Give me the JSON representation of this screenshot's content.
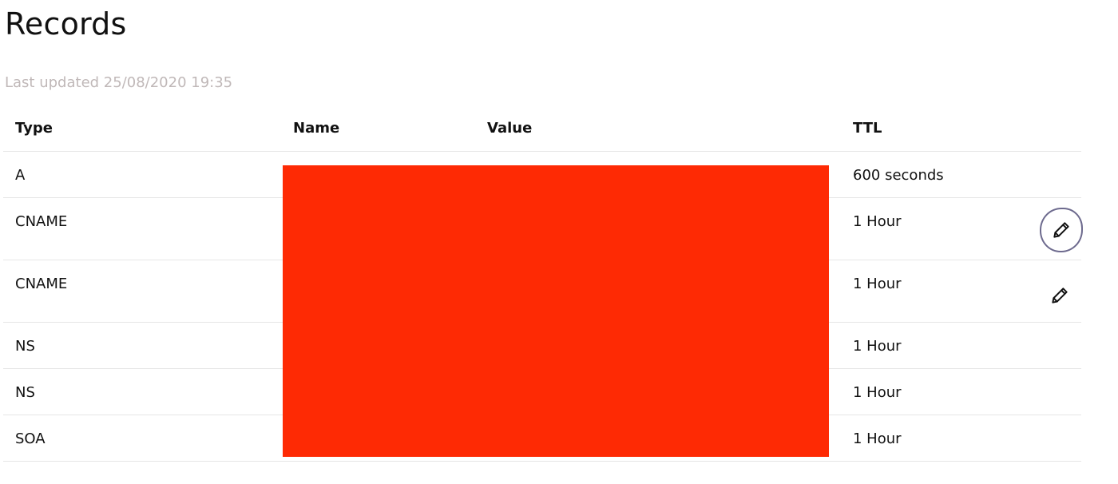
{
  "page": {
    "title": "Records",
    "last_updated": "Last updated 25/08/2020 19:35"
  },
  "table": {
    "columns": {
      "type": "Type",
      "name": "Name",
      "value": "Value",
      "ttl": "TTL"
    },
    "rows": [
      {
        "type": "A",
        "ttl": "600 seconds"
      },
      {
        "type": "CNAME",
        "ttl": "1 Hour"
      },
      {
        "type": "CNAME",
        "ttl": "1 Hour"
      },
      {
        "type": "NS",
        "ttl": "1 Hour"
      },
      {
        "type": "NS",
        "ttl": "1 Hour"
      },
      {
        "type": "SOA",
        "ttl": "1 Hour"
      }
    ]
  },
  "colors": {
    "redaction": "#fe2a04",
    "circle_annotation": "#6d6a8e"
  },
  "icons": {
    "edit": "pencil-icon"
  }
}
